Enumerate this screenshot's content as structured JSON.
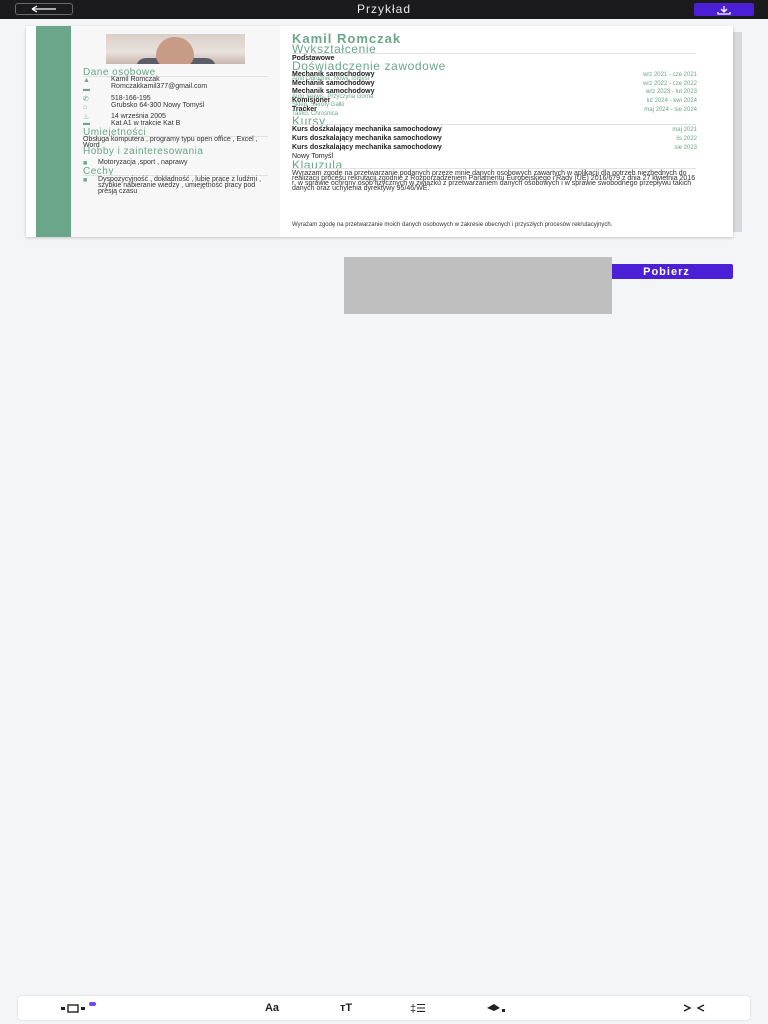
{
  "topbar": {
    "title": "Przykład",
    "back_icon": "arrow-left-icon",
    "download_icon": "download-icon",
    "accent": "#4b1fd6"
  },
  "resume": {
    "name": "Kamil Romczak",
    "left": {
      "personal_heading": "Dane osobowe",
      "personal": [
        {
          "icon": "person-icon",
          "text": "Kamil Romczak"
        },
        {
          "icon": "mail-icon",
          "text": "Romczakkamil377@gmail.com"
        },
        {
          "icon": "phone-icon",
          "text": "518-166-195"
        },
        {
          "icon": "home-icon",
          "text": "Grubsko 64-300 Nowy Tomyśl"
        },
        {
          "icon": "cake-icon",
          "text": "14 września 2005"
        },
        {
          "icon": "car-icon",
          "text": "Kat A1 w trakcie Kat B"
        }
      ],
      "skills_heading": "Umiejętności",
      "skills_text": "Obsługa komputera , programy typu open office , Excel , Word",
      "hobby_heading": "Hobby i zainteresowania",
      "hobby_text": "Motoryzacja ,sport , naprawy",
      "traits_heading": "Cechy",
      "traits_text": "Dyspozycyjność , dokładność , lubię pracę z ludźmi , szybkie nabieranie wiedzy , umiejętność pracy pod presją czasu"
    },
    "right": {
      "education_heading": "Wykształcenie",
      "education_item": "Podstawowe",
      "experience_heading": "Doświadczenie zawodowe",
      "experience": [
        {
          "title": "Mechanik samochodowy",
          "company": "Auto Ogrodnik, Nowy Tomyśl",
          "dates": "wrz 2021 - cze 2021"
        },
        {
          "title": "Mechanik samochodowy",
          "company": "",
          "dates": "wrz 2022 - cze 2022"
        },
        {
          "title": "Mechanik samochodowy",
          "company": "Auto Serwis, Przyczyna Gorna",
          "dates": "wrz 2023 - lut 2023"
        },
        {
          "title": "Komisjoner",
          "company": "Sklep, Sieroty Gałki",
          "dates": "lut 2024 - kwi 2024"
        },
        {
          "title": "Tracker",
          "company": "Tasko, Chrośnica",
          "dates": "maj 2024 - sie 2024"
        }
      ],
      "courses_heading": "Kursy",
      "courses": [
        {
          "title": "Kurs doszkalający mechanika samochodowy",
          "dates": "maj 2021"
        },
        {
          "title": "Kurs doszkalający mechanika samochodowy",
          "dates": "lis 2022"
        },
        {
          "title": "Kurs doszkalający mechanika samochodowy",
          "dates": "sie 2023"
        }
      ],
      "courses_place": "Nowy Tomyśl",
      "clause_heading": "Klauzula",
      "clause_text": "Wyrażam zgodę na przetwarzanie podanych przeze mnie danych osobowych zawartych w aplikacji dla potrzeb niezbędnych do realizacji procesu rekrutacji zgodnie z Rozporządzeniem Parlamentu Europejskiego i Rady (UE) 2016/679 z dnia 27 kwietnia 2016 r. w sprawie ochrony osób fizycznych w związku z przetwarzaniem danych osobowych i w sprawie swobodnego przepływu takich danych oraz uchylenia dyrektywy 95/46/WE.",
      "footer_text": "Wyrażam zgodę na przetwarzanie moich danych osobowych w zakresie obecnych i przyszłych procesów rekrutacyjnych."
    }
  },
  "actions": {
    "download_label": "Pobierz"
  },
  "toolbar": {
    "items": [
      {
        "icon": "layout-icon",
        "label": ""
      },
      {
        "icon": "font-icon",
        "label": "Aa"
      },
      {
        "icon": "text-size-icon",
        "label": "тT"
      },
      {
        "icon": "line-spacing-icon",
        "label": "‡☰"
      },
      {
        "icon": "color-fill-icon",
        "label": ""
      },
      {
        "icon": "collapse-icon",
        "label": ""
      }
    ]
  }
}
